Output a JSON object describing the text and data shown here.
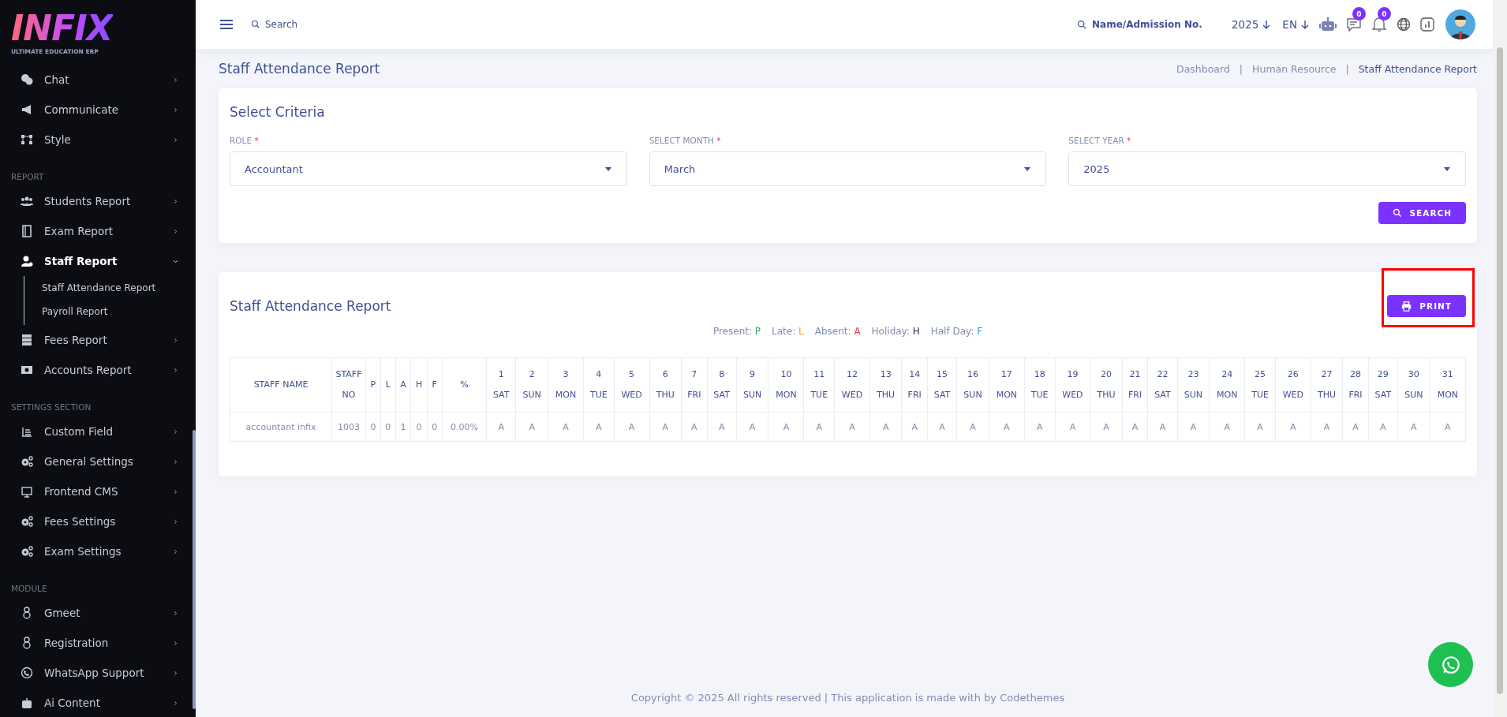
{
  "logo": {
    "name": "INFIX",
    "tagline": "ULTIMATE EDUCATION ERP"
  },
  "sidebar": {
    "sections": [
      {
        "items": [
          {
            "label": "Chat",
            "expanded": false
          },
          {
            "label": "Communicate",
            "expanded": false
          },
          {
            "label": "Style",
            "expanded": false
          }
        ]
      },
      {
        "title": "REPORT",
        "items": [
          {
            "label": "Students Report",
            "expanded": false
          },
          {
            "label": "Exam Report",
            "expanded": false
          },
          {
            "label": "Staff Report",
            "expanded": true,
            "children": [
              {
                "label": "Staff Attendance Report"
              },
              {
                "label": "Payroll Report"
              }
            ]
          },
          {
            "label": "Fees Report",
            "expanded": false
          },
          {
            "label": "Accounts Report",
            "expanded": false
          }
        ]
      },
      {
        "title": "SETTINGS SECTION",
        "items": [
          {
            "label": "Custom Field",
            "expanded": false
          },
          {
            "label": "General Settings",
            "expanded": false
          },
          {
            "label": "Frontend CMS",
            "expanded": false
          },
          {
            "label": "Fees Settings",
            "expanded": false
          },
          {
            "label": "Exam Settings",
            "expanded": false
          }
        ]
      },
      {
        "title": "MODULE",
        "items": [
          {
            "label": "Gmeet",
            "expanded": false
          },
          {
            "label": "Registration",
            "expanded": false
          },
          {
            "label": "WhatsApp Support",
            "expanded": false
          },
          {
            "label": "Ai Content",
            "expanded": false
          }
        ]
      }
    ]
  },
  "topbar": {
    "search": {
      "placeholder": "Search"
    },
    "student_search": {
      "placeholder": "Name/Admission No."
    },
    "year": "2025",
    "language": "EN",
    "chat_badge": "0",
    "notification_badge": "0"
  },
  "page_title": "Staff Attendance Report",
  "breadcrumb_separator": "|",
  "breadcrumbs": [
    {
      "label": "Dashboard",
      "current": false
    },
    {
      "label": "Human Resource",
      "current": false
    },
    {
      "label": "Staff Attendance Report",
      "current": true
    }
  ],
  "criteria": {
    "title": "Select Criteria",
    "required_mark": "*",
    "fields": [
      {
        "label": "ROLE",
        "required": true,
        "value": "Accountant"
      },
      {
        "label": "SELECT MONTH",
        "required": true,
        "value": "March"
      },
      {
        "label": "SELECT YEAR",
        "required": true,
        "value": "2025"
      }
    ],
    "search_button": "SEARCH"
  },
  "report": {
    "title": "Staff Attendance Report",
    "print_button": {
      "label": "PRINT",
      "highlighted": true
    },
    "legend": [
      {
        "label": "Present:",
        "code": "P",
        "color": "#2eab5a"
      },
      {
        "label": "Late:",
        "code": "L",
        "color": "#f4a70a"
      },
      {
        "label": "Absent:",
        "code": "A",
        "color": "#e5364b"
      },
      {
        "label": "Holiday:",
        "code": "H",
        "color": "#2a2f4f"
      },
      {
        "label": "Half Day:",
        "code": "F",
        "color": "#1ea5c9"
      }
    ],
    "table": {
      "columns": [
        {
          "label": "STAFF NAME"
        },
        {
          "label": "STAFF NO"
        },
        {
          "label": "P"
        },
        {
          "label": "L"
        },
        {
          "label": "A"
        },
        {
          "label": "H"
        },
        {
          "label": "F"
        },
        {
          "label": "%"
        },
        {
          "label": "1",
          "sub": "SAT"
        },
        {
          "label": "2",
          "sub": "SUN"
        },
        {
          "label": "3",
          "sub": "MON"
        },
        {
          "label": "4",
          "sub": "TUE"
        },
        {
          "label": "5",
          "sub": "WED"
        },
        {
          "label": "6",
          "sub": "THU"
        },
        {
          "label": "7",
          "sub": "FRI"
        },
        {
          "label": "8",
          "sub": "SAT"
        },
        {
          "label": "9",
          "sub": "SUN"
        },
        {
          "label": "10",
          "sub": "MON"
        },
        {
          "label": "11",
          "sub": "TUE"
        },
        {
          "label": "12",
          "sub": "WED"
        },
        {
          "label": "13",
          "sub": "THU"
        },
        {
          "label": "14",
          "sub": "FRI"
        },
        {
          "label": "15",
          "sub": "SAT"
        },
        {
          "label": "16",
          "sub": "SUN"
        },
        {
          "label": "17",
          "sub": "MON"
        },
        {
          "label": "18",
          "sub": "TUE"
        },
        {
          "label": "19",
          "sub": "WED"
        },
        {
          "label": "20",
          "sub": "THU"
        },
        {
          "label": "21",
          "sub": "FRI"
        },
        {
          "label": "22",
          "sub": "SAT"
        },
        {
          "label": "23",
          "sub": "SUN"
        },
        {
          "label": "24",
          "sub": "MON"
        },
        {
          "label": "25",
          "sub": "TUE"
        },
        {
          "label": "26",
          "sub": "WED"
        },
        {
          "label": "27",
          "sub": "THU"
        },
        {
          "label": "28",
          "sub": "FRI"
        },
        {
          "label": "29",
          "sub": "SAT"
        },
        {
          "label": "30",
          "sub": "SUN"
        },
        {
          "label": "31",
          "sub": "MON"
        }
      ],
      "rows": [
        [
          "accountant infix",
          "1003",
          "0",
          "0",
          "1",
          "0",
          "0",
          "0.00%",
          "A",
          "A",
          "A",
          "A",
          "A",
          "A",
          "A",
          "A",
          "A",
          "A",
          "A",
          "A",
          "A",
          "A",
          "A",
          "A",
          "A",
          "A",
          "A",
          "A",
          "A",
          "A",
          "A",
          "A",
          "A",
          "A",
          "A",
          "A",
          "A",
          "A",
          "A"
        ]
      ]
    }
  },
  "footer": "Copyright © 2025 All rights reserved | This application is made with by Codethemes"
}
